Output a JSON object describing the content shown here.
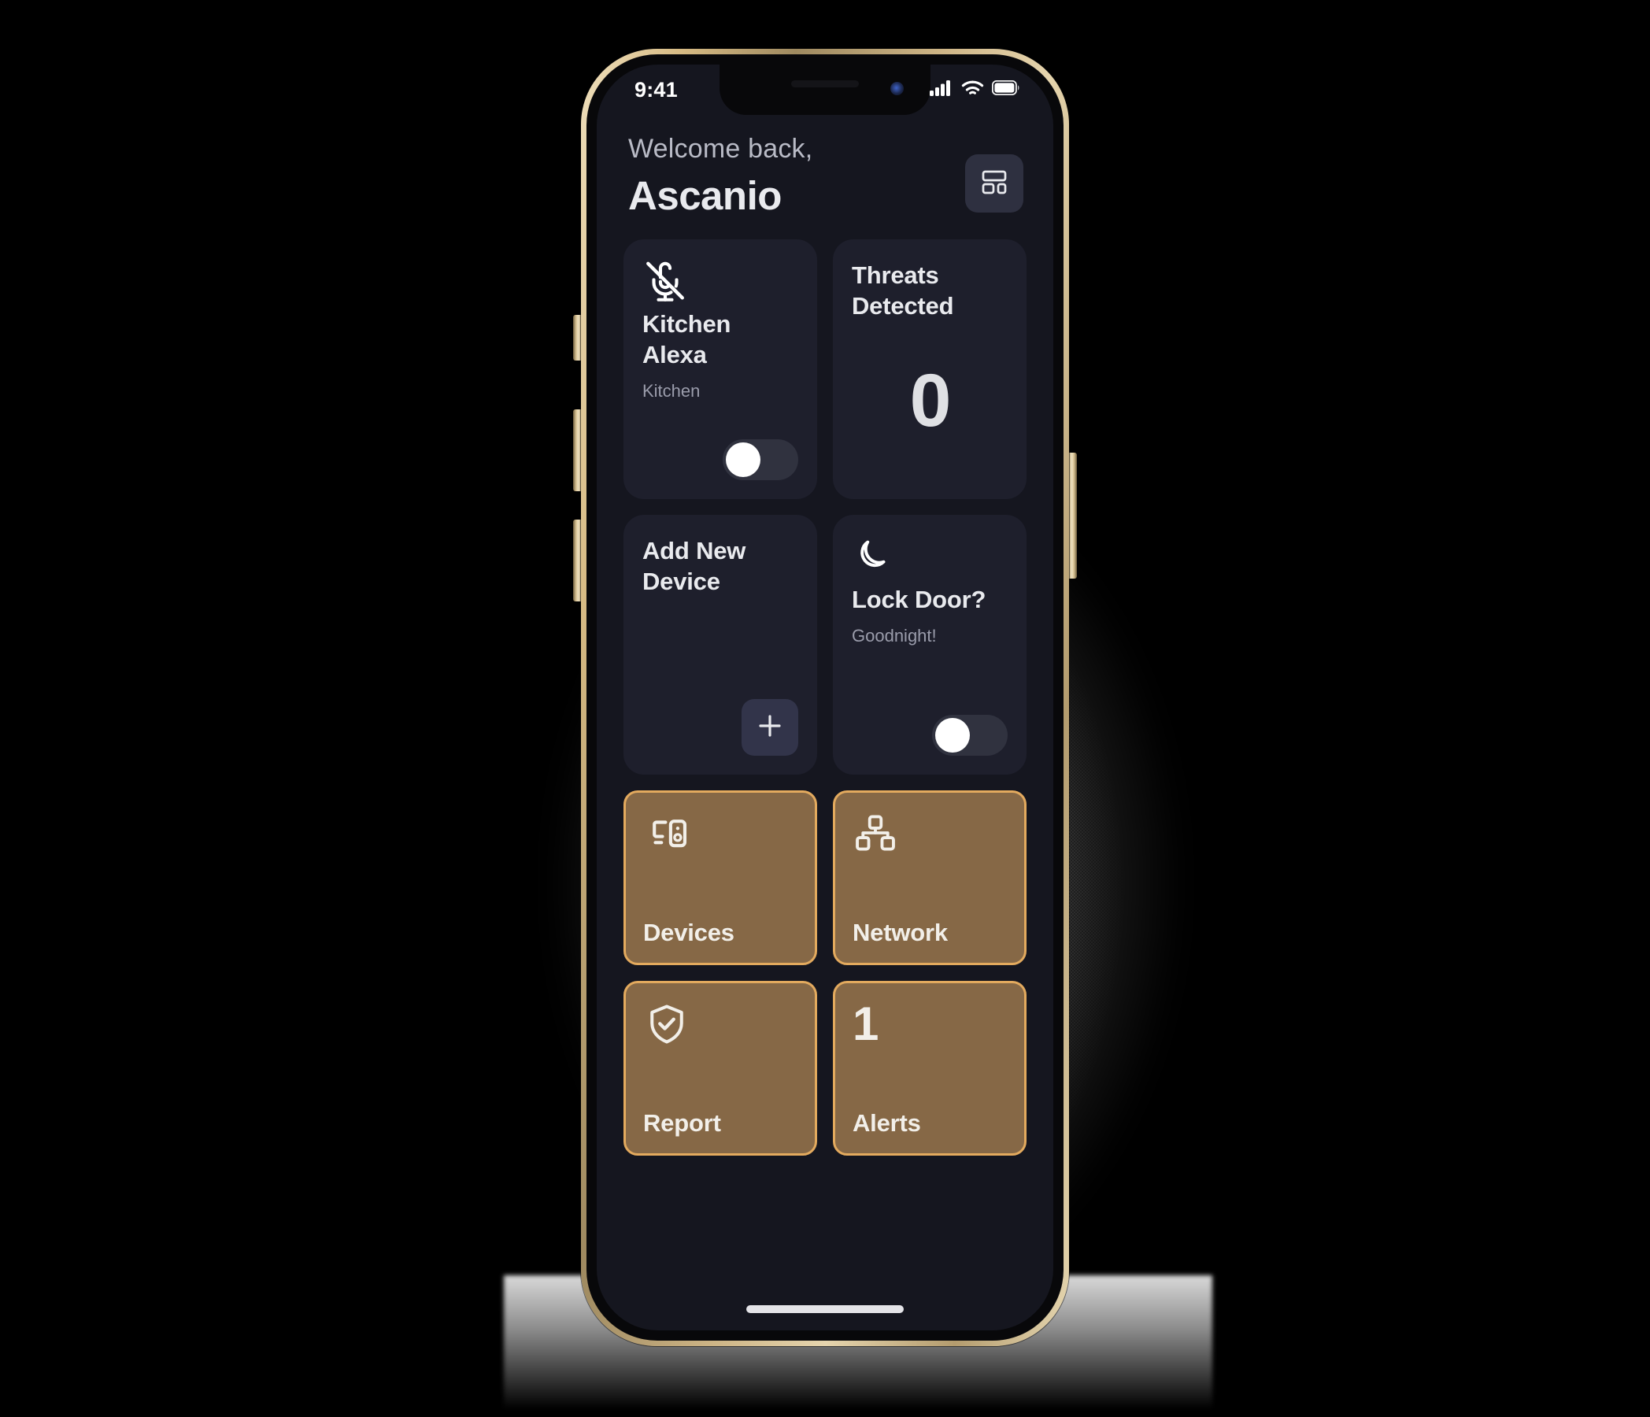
{
  "theme": {
    "screen_bg": "#15161f",
    "card_bg": "#1e1f2c",
    "tile_bg": "#866846",
    "tile_border": "#e3aa5e",
    "text_primary": "#e9eaee",
    "text_secondary": "#9a9cab",
    "frame_gold": "#d7bb84"
  },
  "status_bar": {
    "time": "9:41",
    "icons": [
      "cellular-signal-icon",
      "wifi-icon",
      "battery-icon"
    ],
    "battery_full": true
  },
  "header": {
    "welcome": "Welcome back,",
    "username": "Ascanio",
    "dashboard_button": "dashboard-layout-icon"
  },
  "cards": [
    {
      "id": "kitchen-alexa",
      "icon": "microphone-off-icon",
      "title": "Kitchen Alexa",
      "subtitle": "Kitchen",
      "control": "toggle",
      "toggle_on": false
    },
    {
      "id": "threats-detected",
      "icon": null,
      "title": "Threats Detected",
      "title_line1": "Threats",
      "title_line2": "Detected",
      "value": "0",
      "control": "value"
    },
    {
      "id": "add-new-device",
      "icon": null,
      "title": "Add New Device",
      "title_line1": "Add New",
      "title_line2": "Device",
      "control": "plus-button",
      "button_icon": "plus-icon"
    },
    {
      "id": "lock-door",
      "icon": "moon-icon",
      "title": "Lock Door?",
      "subtitle": "Goodnight!",
      "control": "toggle",
      "toggle_on": false
    }
  ],
  "tiles": [
    {
      "id": "devices",
      "label": "Devices",
      "icon": "devices-monitor-tower-icon",
      "badge": null
    },
    {
      "id": "network",
      "label": "Network",
      "icon": "network-hierarchy-icon",
      "badge": null
    },
    {
      "id": "report",
      "label": "Report",
      "icon": "shield-check-icon",
      "badge": null
    },
    {
      "id": "alerts",
      "label": "Alerts",
      "icon": null,
      "badge": "1"
    }
  ],
  "home_indicator": true
}
